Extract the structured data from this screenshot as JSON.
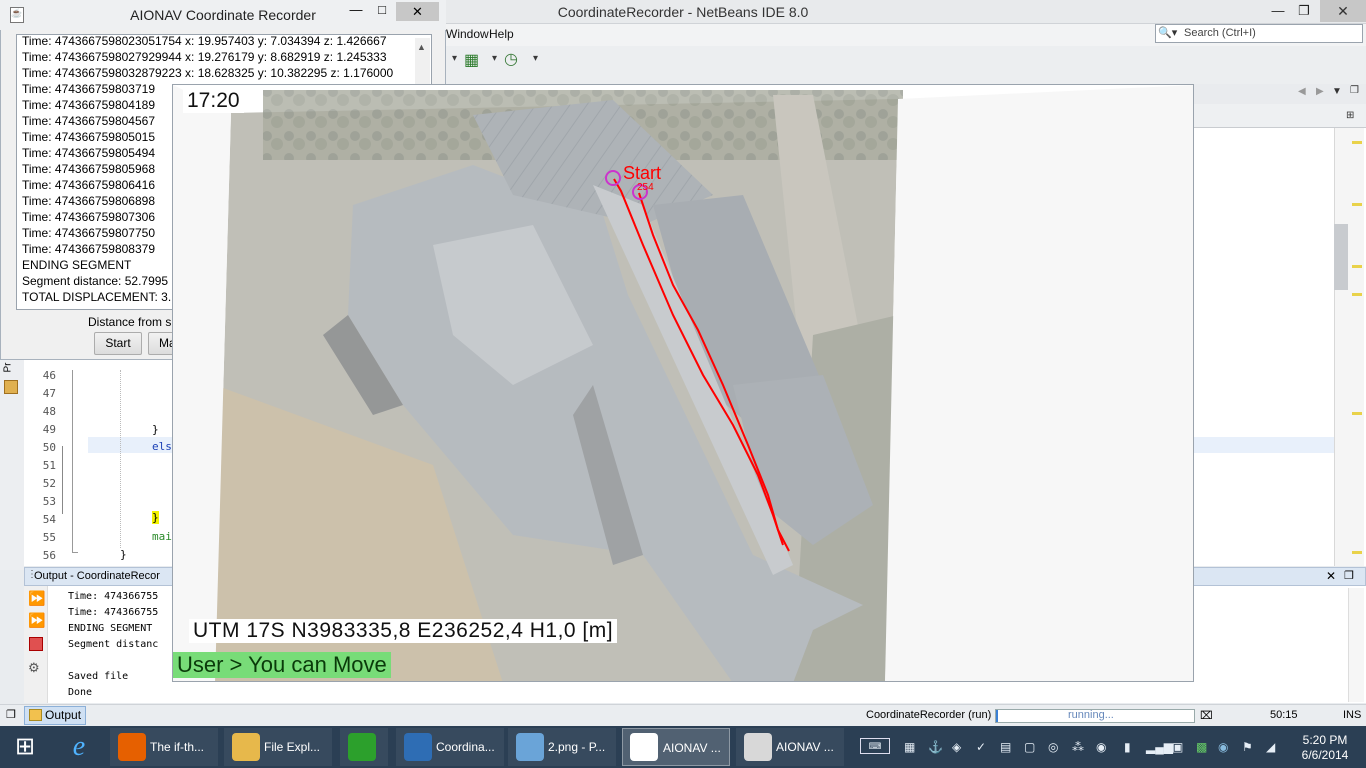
{
  "netbeans": {
    "title": "CoordinateRecorder - NetBeans IDE 8.0",
    "menu": [
      "Window",
      "Help"
    ],
    "search_placeholder": "Search (Ctrl+I)",
    "left_panel_label": "Pr",
    "line_numbers": [
      "46",
      "47",
      "48",
      "49",
      "50",
      "51",
      "52",
      "53",
      "54",
      "55",
      "56"
    ],
    "code": {
      "brace_close": "}",
      "else_kw": "els",
      "brace_yellow": "}",
      "call": "mai",
      "brace_end": "}"
    },
    "output": {
      "tab_title": "Output - CoordinateRecor",
      "lines": [
        "Time: 474366755",
        "Time: 474366755",
        "ENDING SEGMENT",
        "Segment distanc",
        "",
        "Saved file",
        "Done"
      ],
      "bottom_tab": "Output"
    },
    "status": {
      "run_label": "CoordinateRecorder (run)",
      "progress_text": "running...",
      "caret_position": "50:15",
      "insert_mode": "INS"
    }
  },
  "recorder": {
    "title": "AIONAV Coordinate Recorder",
    "log_lines": [
      "Time: 4743667598023051754 x: 19.957403 y: 7.034394 z: 1.426667",
      "Time: 4743667598027929944 x: 19.276179 y: 8.682919 z: 1.245333",
      "Time: 4743667598032879223 x: 18.628325 y: 10.382295 z: 1.176000",
      "Time: 474366759803719",
      "Time: 474366759804189",
      "Time: 474366759804567",
      "Time: 474366759805015",
      "Time: 474366759805494",
      "Time: 474366759805968",
      "Time: 474366759806416",
      "Time: 474366759806898",
      "Time: 474366759807306",
      "Time: 474366759807750",
      "Time: 474366759808379",
      "ENDING SEGMENT",
      "Segment distance: 52.7995",
      "TOTAL DISPLACEMENT: 3."
    ],
    "distance_label": "Distance from s",
    "buttons": {
      "start": "Start",
      "mark": "Ma"
    }
  },
  "map": {
    "time": "17:20",
    "start_label": "Start",
    "waypoint_label": "254",
    "utm": "UTM 17S  N3983335,8  E236252,4  H1,0 [m]",
    "status": "User > You can Move",
    "colors": {
      "track": "#ff0000",
      "marker": "#cc33cc",
      "status_bg": "#78dc78"
    }
  },
  "taskbar": {
    "items": [
      {
        "label": "The if-th...",
        "icon": "firefox-icon"
      },
      {
        "label": "File Expl...",
        "icon": "folder-icon"
      },
      {
        "label": "",
        "icon": "store-icon"
      },
      {
        "label": "Coordina...",
        "icon": "virtualbox-icon"
      },
      {
        "label": "2.png - P...",
        "icon": "paint-icon"
      },
      {
        "label": "AIONAV ...",
        "icon": "aionav-icon"
      },
      {
        "label": "AIONAV ...",
        "icon": "java-icon"
      }
    ],
    "time": "5:20 PM",
    "date": "6/6/2014"
  }
}
